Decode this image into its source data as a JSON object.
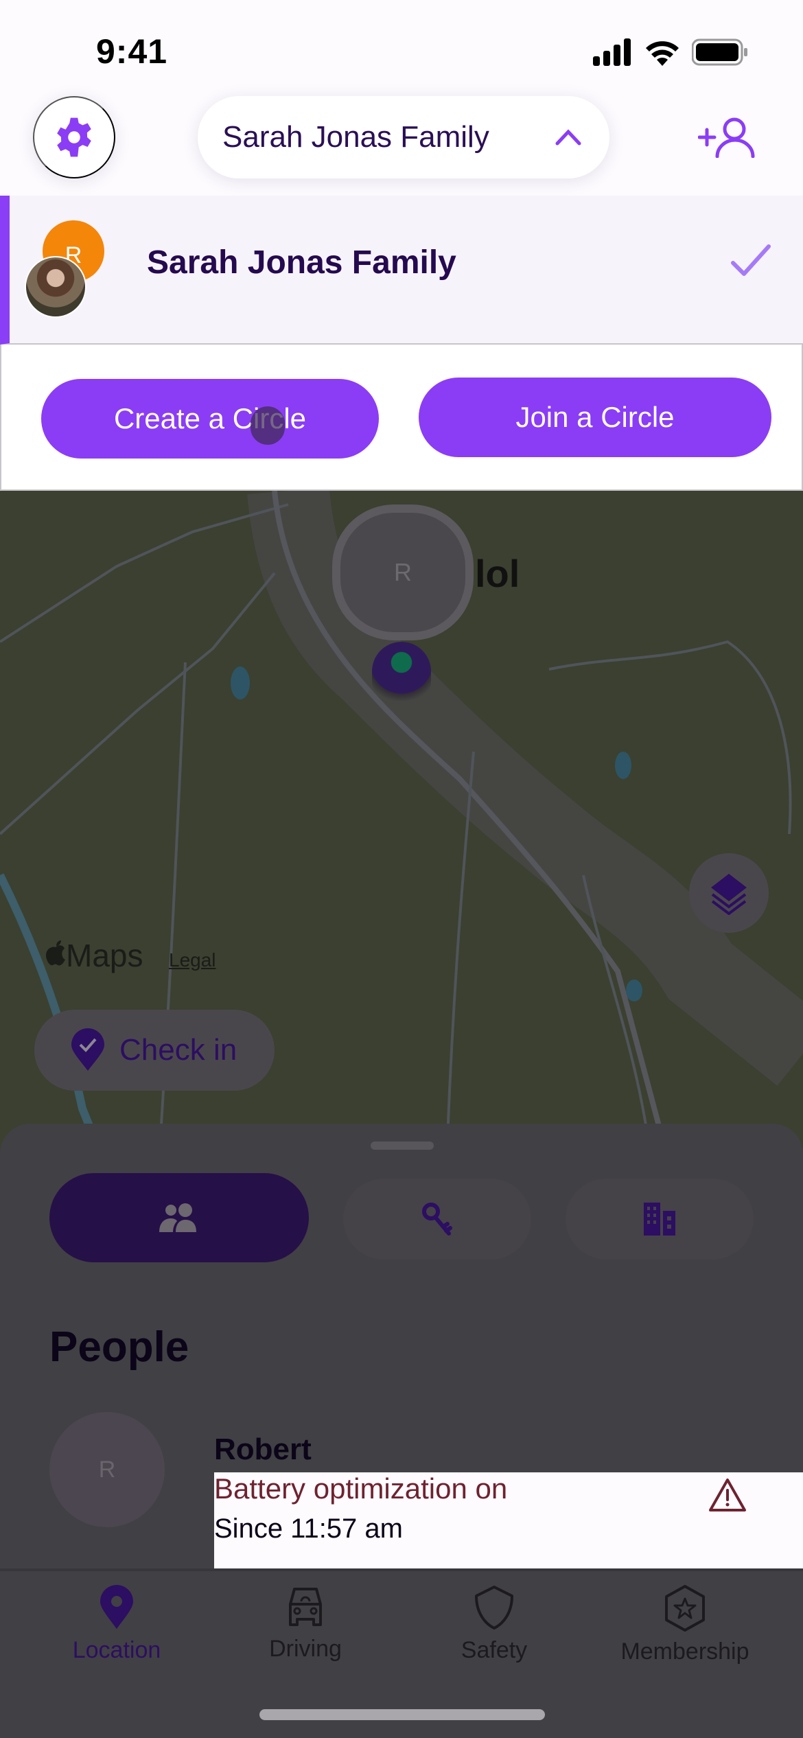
{
  "status_bar": {
    "time": "9:41",
    "signal_icon": "cellular-signal-icon",
    "wifi_icon": "wifi-icon",
    "battery_icon": "battery-icon"
  },
  "header": {
    "settings_icon": "gear-icon",
    "circle_name": "Sarah Jonas Family",
    "dropdown_icon": "chevron-up-icon",
    "add_member_icon": "add-person-icon"
  },
  "circle_dropdown": {
    "items": [
      {
        "name": "Sarah Jonas Family",
        "selected": true,
        "avatar_initial": "R"
      }
    ],
    "create_label": "Create a Circle",
    "join_label": "Join a Circle"
  },
  "map": {
    "member_initial": "R",
    "place_label": "lol",
    "attribution": "Maps",
    "legal_label": "Legal",
    "layers_icon": "layers-icon",
    "check_in_label": "Check in"
  },
  "colors": {
    "accent": "#8b3df5",
    "dark_purple": "#250a4f",
    "warning": "#c0384b",
    "avatar_orange": "#f4860a"
  },
  "sheet": {
    "segments": [
      {
        "name": "people",
        "icon": "people-icon",
        "active": true
      },
      {
        "name": "items",
        "icon": "keys-icon",
        "active": false
      },
      {
        "name": "places",
        "icon": "building-icon",
        "active": false
      }
    ],
    "section_title": "People",
    "people": [
      {
        "initial": "R",
        "name": "Robert",
        "status": "Battery optimization on",
        "since": "Since 11:57 am"
      }
    ]
  },
  "tabbar": {
    "tabs": [
      {
        "label": "Location",
        "active": true
      },
      {
        "label": "Driving",
        "active": false
      },
      {
        "label": "Safety",
        "active": false
      },
      {
        "label": "Membership",
        "active": false
      }
    ]
  }
}
